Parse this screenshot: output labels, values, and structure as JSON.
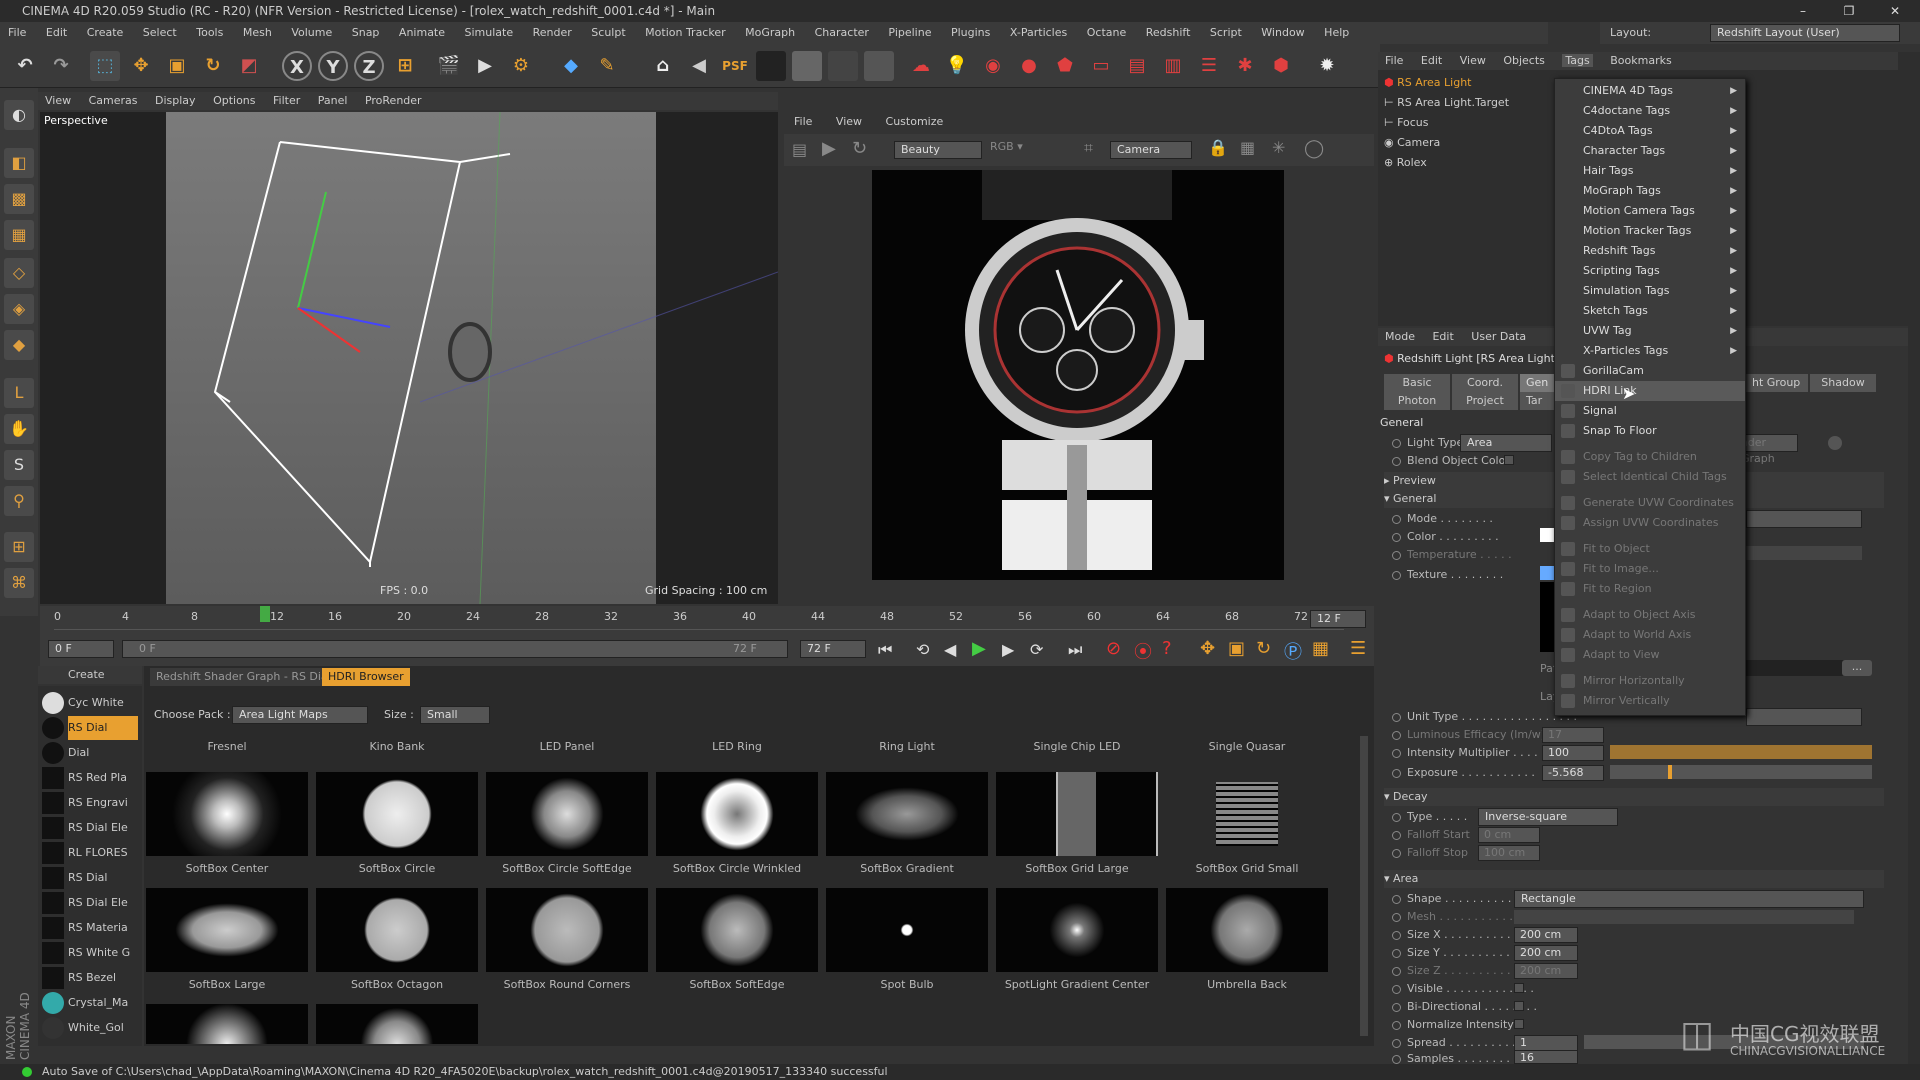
{
  "window": {
    "title": "CINEMA 4D R20.059 Studio (RC - R20) (NFR Version - Restricted License) - [rolex_watch_redshift_0001.c4d *] - Main"
  },
  "menubar": [
    "File",
    "Edit",
    "Create",
    "Select",
    "Tools",
    "Mesh",
    "Volume",
    "Snap",
    "Animate",
    "Simulate",
    "Render",
    "Sculpt",
    "Motion Tracker",
    "MoGraph",
    "Character",
    "Pipeline",
    "Plugins",
    "X-Particles",
    "Octane",
    "Redshift",
    "Script",
    "Window",
    "Help"
  ],
  "layout": {
    "label": "Layout:",
    "value": "Redshift Layout (User)"
  },
  "viewport": {
    "menu": [
      "View",
      "Cameras",
      "Display",
      "Options",
      "Filter",
      "Panel",
      "ProRender"
    ],
    "name": "Perspective",
    "fps": "FPS : 0.0",
    "grid": "Grid Spacing : 100 cm"
  },
  "renderview": {
    "menu": [
      "File",
      "View",
      "Customize"
    ],
    "aov": "Beauty",
    "camera": "Camera"
  },
  "timeline": {
    "ticks": [
      "0",
      "4",
      "8",
      "12",
      "16",
      "20",
      "24",
      "28",
      "32",
      "36",
      "40",
      "44",
      "48",
      "52",
      "56",
      "60",
      "64",
      "68",
      "72"
    ],
    "end_frame": "12 F",
    "current_frame": "0 F",
    "range_start": "0 F",
    "range_end": "72 F",
    "max_frame": "72 F"
  },
  "materials": {
    "menu": [
      "Create"
    ],
    "items": [
      "Cyc White",
      "RS Dial",
      "Dial",
      "RS Red Pla",
      "RS Engravi",
      "RS Dial Ele",
      "RL FLORES",
      "RS Dial",
      "RS Dial Ele",
      "RS Materia",
      "RS White G",
      "RS Bezel",
      "Crystal_Ma",
      "White_Gol"
    ]
  },
  "hdr": {
    "tabs": [
      "Redshift Shader Graph - RS Dial",
      "HDRI Browser"
    ],
    "pack_label": "Choose Pack :",
    "pack_value": "Area Light Maps",
    "size_label": "Size :",
    "size_value": "Small",
    "columns": [
      "Fresnel",
      "Kino Bank",
      "LED Panel",
      "LED Ring",
      "Ring Light",
      "Single Chip LED",
      "Single Quasar"
    ],
    "row1": [
      "SoftBox Center",
      "SoftBox Circle",
      "SoftBox Circle SoftEdge",
      "SoftBox Circle Wrinkled",
      "SoftBox Gradient",
      "SoftBox Grid Large",
      "SoftBox Grid Small"
    ],
    "row2": [
      "SoftBox Large",
      "SoftBox Octagon",
      "SoftBox Round Corners",
      "SoftBox SoftEdge",
      "Spot Bulb",
      "SpotLight Gradient Center",
      "Umbrella Back"
    ]
  },
  "objects": {
    "menu": [
      "File",
      "Edit",
      "View",
      "Objects",
      "Tags",
      "Bookmarks"
    ],
    "items": [
      "RS Area Light",
      "RS Area Light.Target",
      "Focus",
      "Camera",
      "Rolex"
    ]
  },
  "tagsmenu": {
    "submenus": [
      "CINEMA 4D Tags",
      "C4doctane Tags",
      "C4DtoA Tags",
      "Character Tags",
      "Hair Tags",
      "MoGraph Tags",
      "Motion Camera Tags",
      "Motion Tracker Tags",
      "Redshift Tags",
      "Scripting Tags",
      "Simulation Tags",
      "Sketch Tags",
      "UVW Tag",
      "X-Particles Tags"
    ],
    "items": [
      "GorillaCam",
      "HDRI Link",
      "Signal",
      "Snap To Floor"
    ],
    "disabled": [
      "Copy Tag to Children",
      "Select Identical Child Tags",
      "Generate UVW Coordinates",
      "Assign UVW Coordinates",
      "Fit to Object",
      "Fit to Image...",
      "Fit to Region",
      "Adapt to Object Axis",
      "Adapt to World Axis",
      "Adapt to View",
      "Mirror Horizontally",
      "Mirror Vertically"
    ]
  },
  "attributes": {
    "menu": [
      "Mode",
      "Edit",
      "User Data"
    ],
    "title": "Redshift Light [RS Area Light]",
    "tabs_row1": [
      "Basic",
      "Coord.",
      "Gen",
      "ht Group",
      "Shadow"
    ],
    "tabs_row2": [
      "Photon",
      "Project",
      "Tar"
    ],
    "section_general": "General",
    "light_type_label": "Light Type",
    "light_type_value": "Area",
    "blend_label": "Blend Object Color",
    "preview": "Preview",
    "general2": "General",
    "mode": "Mode",
    "color": "Color",
    "temperature": "Temperature",
    "texture": "Texture",
    "unit_type": "Unit Type",
    "lum_efficacy": "Luminous Efficacy (lm/w)",
    "lum_value": "17",
    "intensity": "Intensity Multiplier",
    "intensity_value": "100",
    "exposure": "Exposure",
    "exposure_value": "-5.568",
    "decay": "Decay",
    "type": "Type",
    "type_value": "Inverse-square",
    "falloff_start": "Falloff Start",
    "falloff_start_value": "0 cm",
    "falloff_stop": "Falloff Stop",
    "falloff_stop_value": "100 cm",
    "area": "Area",
    "shape": "Shape",
    "shape_value": "Rectangle",
    "mesh": "Mesh",
    "sizex": "Size X",
    "sizex_value": "200 cm",
    "sizey": "Size Y",
    "sizey_value": "200 cm",
    "sizez": "Size Z",
    "sizez_value": "200 cm",
    "visible": "Visible",
    "bidir": "Bi-Directional",
    "normalize": "Normalize Intensity",
    "spread": "Spread",
    "spread_value": "1",
    "samples": "Samples",
    "samples_value": "16",
    "shader_graph": "ader Graph",
    "path_short": "Pat",
    "layer_short": "Lay"
  },
  "statusbar": "Auto Save of C:\\Users\\chad_\\AppData\\Roaming\\MAXON\\Cinema 4D R20_4FA5020E\\backup\\rolex_watch_redshift_0001.c4d@20190517_133340 successful",
  "watermark": {
    "cn": "中国CG视效联盟",
    "en": "CHINACGVISIONALLIANCE"
  },
  "colors": {
    "accent": "#e8a030",
    "hdr_tab_active": "#e8a030",
    "red": "#d03030"
  }
}
